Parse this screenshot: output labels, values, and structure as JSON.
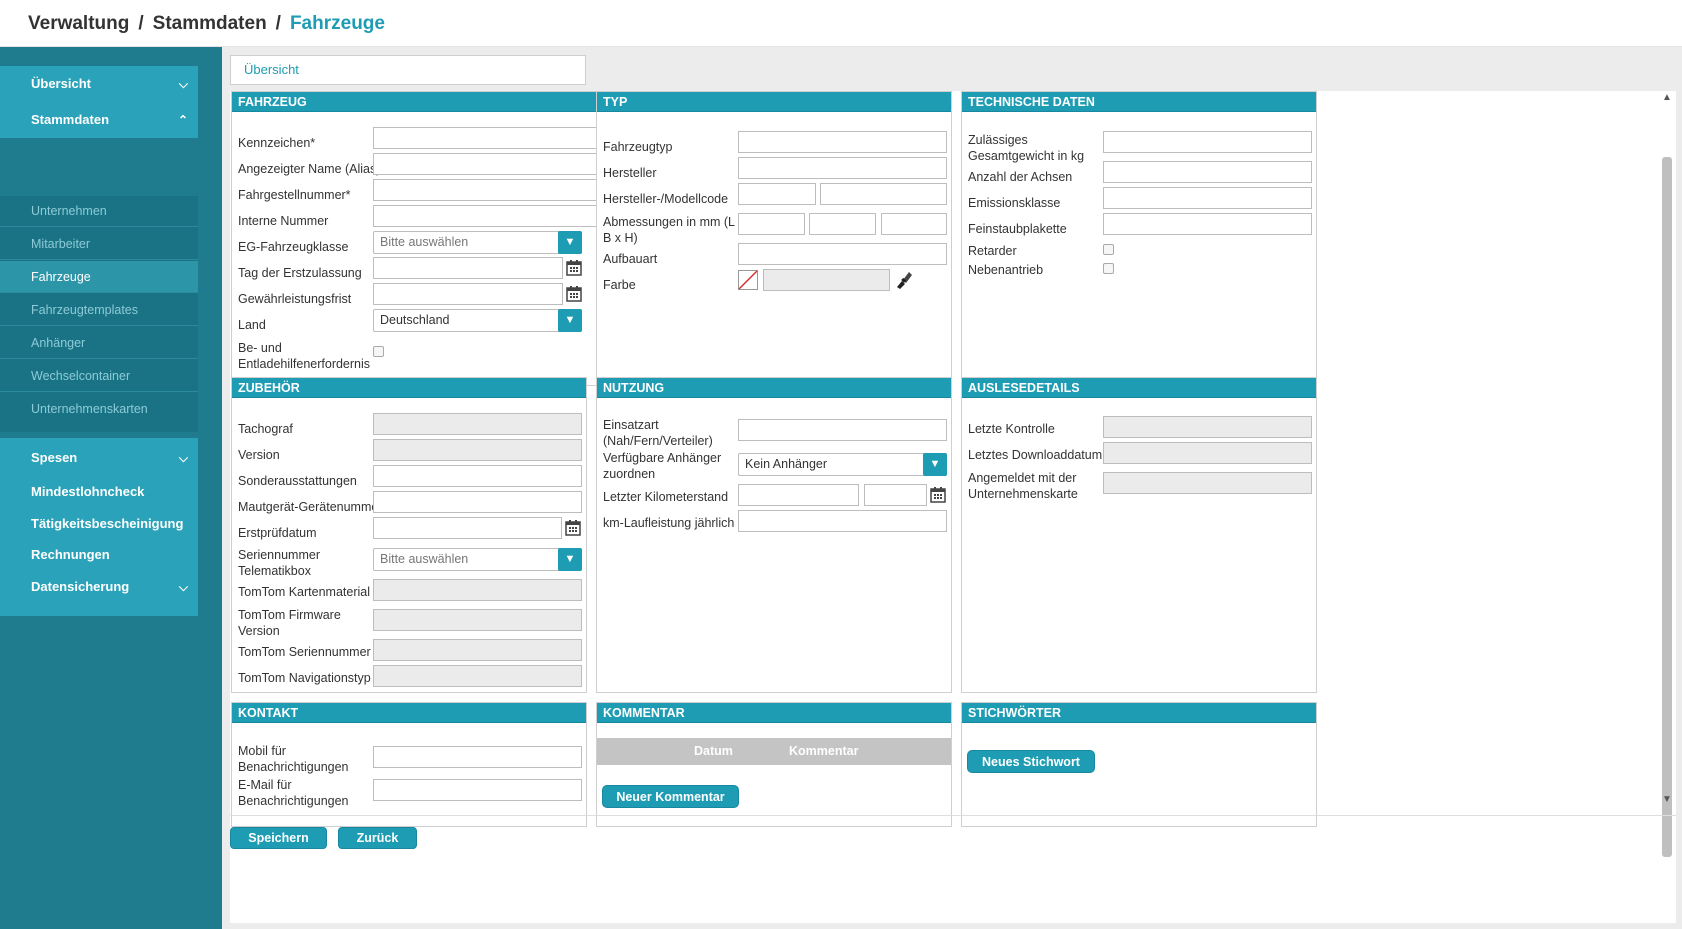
{
  "breadcrumb": {
    "part1": "Verwaltung",
    "sep": "/",
    "part2": "Stammdaten",
    "current": "Fahrzeuge"
  },
  "sidebar": {
    "uebersicht": "Übersicht",
    "stammdaten": "Stammdaten",
    "sub_items": [
      "Unternehmen",
      "Mitarbeiter",
      "Fahrzeuge",
      "Fahrzeugtemplates",
      "Anhänger",
      "Wechselcontainer",
      "Unternehmenskarten"
    ],
    "spesen": "Spesen",
    "mindestlohncheck": "Mindestlohncheck",
    "taetigkeit": "Tätigkeitsbescheinigung",
    "rechnungen": "Rechnungen",
    "datensicherung": "Datensicherung"
  },
  "tab": {
    "label": "Übersicht"
  },
  "fahrzeug": {
    "title": "FAHRZEUG",
    "kennzeichen": "Kennzeichen*",
    "alias": "Angezeigter Name (Alias)",
    "fahrgestell": "Fahrgestellnummer*",
    "intern": "Interne Nummer",
    "eg_klasse": "EG-Fahrzeugklasse",
    "eg_placeholder": "Bitte auswählen",
    "erstzulassung": "Tag der Erstzulassung",
    "gewaehr": "Gewährleistungsfrist",
    "land": "Land",
    "land_value": "Deutschland",
    "be_ent_1": "Be- und",
    "be_ent_2": "Entladehilfenerfordernis"
  },
  "typ": {
    "title": "TYP",
    "fahrzeugtyp": "Fahrzeugtyp",
    "hersteller": "Hersteller",
    "modellcode": "Hersteller-/Modellcode",
    "abm_1": "Abmessungen in mm (L x",
    "abm_2": "B x H)",
    "aufbauart": "Aufbauart",
    "farbe": "Farbe"
  },
  "technisch": {
    "title": "TECHNISCHE DATEN",
    "gewicht_1": "Zulässiges",
    "gewicht_2": "Gesamtgewicht in kg",
    "achsen": "Anzahl der Achsen",
    "emission": "Emissionsklasse",
    "feinstaub": "Feinstaubplakette",
    "retarder": "Retarder",
    "nebenantrieb": "Nebenantrieb"
  },
  "zubehoer": {
    "title": "ZUBEHÖR",
    "tachograf": "Tachograf",
    "version": "Version",
    "sonder": "Sonderausstattungen",
    "maut": "Mautgerät-Gerätenummer",
    "erstpruef": "Erstprüfdatum",
    "serien_1": "Seriennummer",
    "serien_2": "Telematikbox",
    "serien_placeholder": "Bitte auswählen",
    "karten": "TomTom Kartenmaterial",
    "fw_1": "TomTom Firmware",
    "fw_2": "Version",
    "tt_serien": "TomTom Seriennummer",
    "tt_navi": "TomTom Navigationstyp"
  },
  "nutzung": {
    "title": "NUTZUNG",
    "einsatz_1": "Einsatzart",
    "einsatz_2": "(Nah/Fern/Verteiler)",
    "anh_1": "Verfügbare Anhänger",
    "anh_2": "zuordnen",
    "anh_value": "Kein Anhänger",
    "km": "Letzter Kilometerstand",
    "laufleistung": "km-Laufleistung jährlich"
  },
  "auslese": {
    "title": "AUSLESEDETAILS",
    "kontrolle": "Letzte Kontrolle",
    "download": "Letztes Downloaddatum",
    "angem_1": "Angemeldet mit der",
    "angem_2": "Unternehmenskarte"
  },
  "kontakt": {
    "title": "KONTAKT",
    "mobil_1": "Mobil für",
    "mobil_2": "Benachrichtigungen",
    "email_1": "E-Mail für",
    "email_2": "Benachrichtigungen"
  },
  "kommentar": {
    "title": "KOMMENTAR",
    "col_datum": "Datum",
    "col_kommentar": "Kommentar",
    "button": "Neuer Kommentar"
  },
  "stichwoerter": {
    "title": "STICHWÖRTER",
    "button": "Neues Stichwort"
  },
  "footer": {
    "save": "Speichern",
    "back": "Zurück"
  },
  "icons": {
    "calendar": "calendar-icon",
    "chevron": "chevron-down-icon",
    "color_picker": "paint-brush-icon"
  },
  "colors": {
    "accent": "#1e9cb3",
    "sidebar": "#1e7c8e",
    "sidebar_active": "#2aa2b9"
  }
}
